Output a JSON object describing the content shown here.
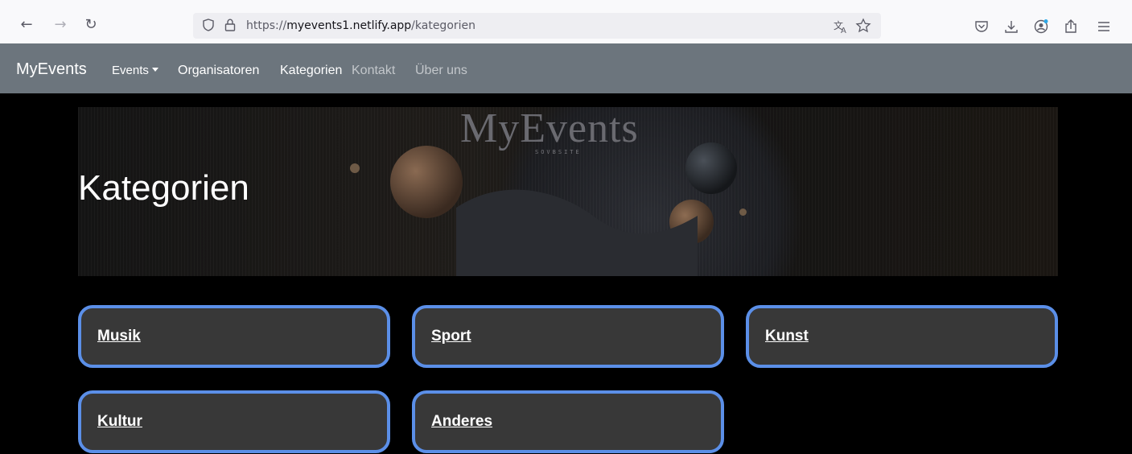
{
  "browser": {
    "url_prefix": "https://",
    "url_host": "myevents1.netlify.app",
    "url_path": "/kategorien",
    "back_icon": "arrow-left-icon",
    "forward_icon": "arrow-right-icon",
    "reload_icon": "reload-icon"
  },
  "navbar": {
    "brand": "MyEvents",
    "items": [
      {
        "label": "Events",
        "dropdown": true
      },
      {
        "label": "Organisatoren"
      },
      {
        "label": "Kategorien"
      },
      {
        "label": "Kontakt"
      },
      {
        "label": "Über uns"
      }
    ],
    "bg_color": "#6c757d"
  },
  "hero": {
    "title": "Kategorien",
    "logo_text": "MyEvents",
    "logo_sub": "SOVBSITE"
  },
  "categories": [
    {
      "label": "Musik"
    },
    {
      "label": "Sport"
    },
    {
      "label": "Kunst"
    },
    {
      "label": "Kultur"
    },
    {
      "label": "Anderes"
    }
  ],
  "colors": {
    "card_border": "#5b8fe8",
    "card_bg": "#383838",
    "page_bg": "#000000"
  }
}
